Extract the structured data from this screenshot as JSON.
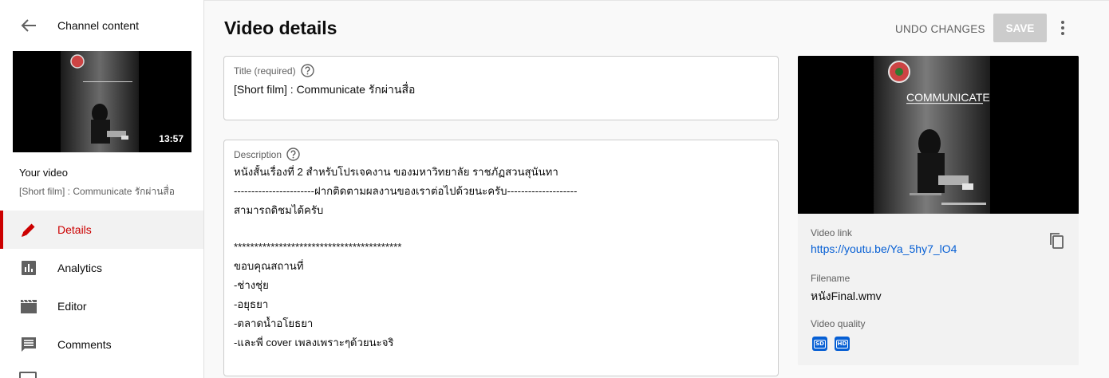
{
  "sidebar": {
    "title": "Channel content",
    "thumbnail_duration": "13:57",
    "your_video_label": "Your video",
    "video_title": "[Short film] : Communicate รักผ่านสื่อ",
    "nav": [
      {
        "label": "Details",
        "icon": "pencil-icon",
        "active": true
      },
      {
        "label": "Analytics",
        "icon": "analytics-icon",
        "active": false
      },
      {
        "label": "Editor",
        "icon": "clapperboard-icon",
        "active": false
      },
      {
        "label": "Comments",
        "icon": "comment-icon",
        "active": false
      }
    ]
  },
  "header": {
    "title": "Video details",
    "undo_label": "UNDO CHANGES",
    "save_label": "SAVE"
  },
  "title_field": {
    "label": "Title (required)",
    "value": "[Short film] : Communicate รักผ่านสื่อ"
  },
  "description_field": {
    "label": "Description",
    "lines": [
      "หนังสั้นเรื่องที่ 2 สำหรับโปรเจคงาน ของมหาวิทยาลัย ราชภัฏสวนสุนันทา",
      "-----------------------ฝากติดตามผลงานของเราต่อไปด้วยนะครับ--------------------",
      "สามารถดิชมได้ครับ",
      "",
      "*****************************************",
      "ขอบคุณสถานที่",
      "-ช่างชุ่ย",
      "-อยุธยา",
      "-ตลาดน้ำอโยธยา",
      "-และพี่ cover เพลงเพราะๆด้วยนะจริ"
    ]
  },
  "right_panel": {
    "video_link_label": "Video link",
    "video_link": "https://youtu.be/Ya_5hy7_lO4",
    "filename_label": "Filename",
    "filename": "หนังFinal.wmv",
    "quality_label": "Video quality",
    "quality_badges": [
      "SD",
      "HD"
    ],
    "poster_title": "COMMUNICATE"
  },
  "colors": {
    "accent_red": "#cc0000",
    "link_blue": "#065fd4",
    "save_disabled": "#cccccc"
  }
}
